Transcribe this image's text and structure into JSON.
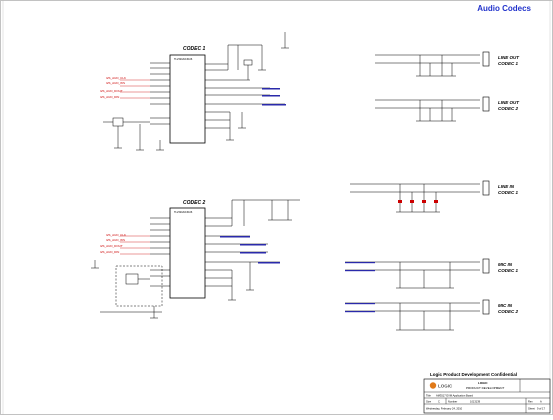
{
  "header": {
    "title": "Audio Codecs"
  },
  "codec1": {
    "label": "CODEC 1",
    "part": "TLV320AIC3106",
    "nets_left": [
      "I2S_AUD_CLK",
      "I2S_AUD_WS",
      "I2S_AUD_DOUT",
      "I2S_AUD_DIN"
    ]
  },
  "codec2": {
    "label": "CODEC 2",
    "part": "TLV320AIC3106",
    "nets_left": [
      "I2S_AUD_CLK",
      "I2S_AUD_WS",
      "I2S_AUD_DOUT",
      "I2S_AUD_DIN"
    ]
  },
  "connectors": [
    {
      "line1": "LINE OUT",
      "line2": "CODEC 1"
    },
    {
      "line1": "LINE OUT",
      "line2": "CODEC 2"
    },
    {
      "line1": "LINE IN",
      "line2": "CODEC 1"
    },
    {
      "line1": "MIC IN",
      "line2": "CODEC 1"
    },
    {
      "line1": "MIC IN",
      "line2": "CODEC 2"
    }
  ],
  "title_block": {
    "confidential": "Logic Product Development Confidential",
    "company": "LOGIC",
    "dept": "PRODUCT DEVELOPMENT",
    "title_label": "Title",
    "title_value": "AM3517 EVM Application Board",
    "size_label": "Size",
    "size_value": "C",
    "number_label": "Number",
    "number_value": "1013139",
    "rev_label": "Rev",
    "rev_value": "A",
    "date_value": "Wednesday, February 24, 2010",
    "sheet_label": "Sheet",
    "sheet_value": "9 of 17"
  }
}
